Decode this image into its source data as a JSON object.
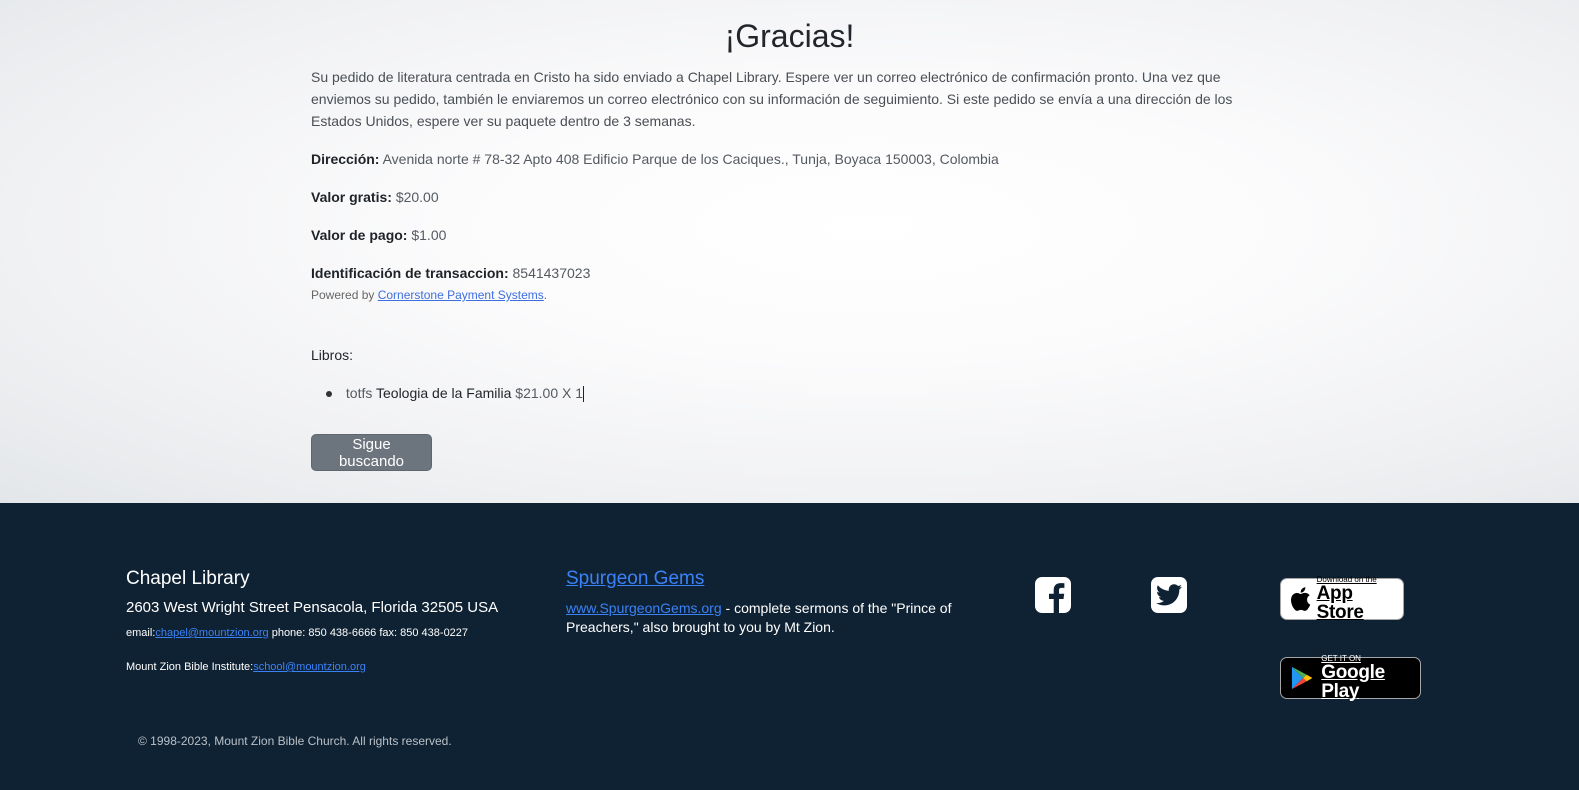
{
  "main": {
    "title": "¡Gracias!",
    "message": "Su pedido de literatura centrada en Cristo ha sido enviado a Chapel Library. Espere ver un correo electrónico de confirmación pronto. Una vez que enviemos su pedido, también le enviaremos un correo electrónico con su información de seguimiento. Si este pedido se envía a una dirección de los Estados Unidos, espere ver su paquete dentro de 3 semanas.",
    "address_label": "Dirección:",
    "address_value": "Avenida norte # 78-32 Apto 408 Edificio Parque de los Caciques., Tunja, Boyaca 150003, Colombia",
    "free_label": "Valor gratis:",
    "free_value": "$20.00",
    "pay_label": "Valor de pago:",
    "pay_value": "$1.00",
    "txn_label": "Identificación de transaccion:",
    "txn_value": "8541437023",
    "powered_prefix": "Powered by",
    "powered_link": "Cornerstone Payment Systems",
    "powered_suffix": ".",
    "books_label": "Libros:",
    "book": {
      "code": "totfs",
      "name": "Teologia de la Familia",
      "price_qty": "$21.00 X 1"
    },
    "continue_button": "Sigue buscando"
  },
  "footer": {
    "org_name": "Chapel Library",
    "address": "2603 West Wright Street Pensacola, Florida 32505 USA",
    "email_label": "email:",
    "email": "chapel@mountzion.org",
    "phone_fax": "phone: 850 438-6666 fax: 850 438-0227",
    "institute_label": "Mount Zion Bible Institute:",
    "institute_email": "school@mountzion.org",
    "gems_title": "Spurgeon Gems",
    "gems_link": "www.SpurgeonGems.org",
    "gems_desc": " - complete sermons of the \"Prince of Preachers,\" also brought to you by Mt Zion.",
    "appstore_small": "Download on the",
    "appstore_big": "App Store",
    "googleplay_small": "GET IT ON",
    "googleplay_big": "Google Play",
    "copyright": "© 1998-2023, Mount Zion Bible Church. All rights reserved."
  },
  "icons": {
    "facebook": "facebook-icon",
    "twitter": "twitter-icon",
    "apple": "apple-icon",
    "google_play": "google-play-icon"
  },
  "colors": {
    "footer_bg": "#0f2233",
    "button_bg": "#6c757d",
    "link": "#3b82f6"
  }
}
